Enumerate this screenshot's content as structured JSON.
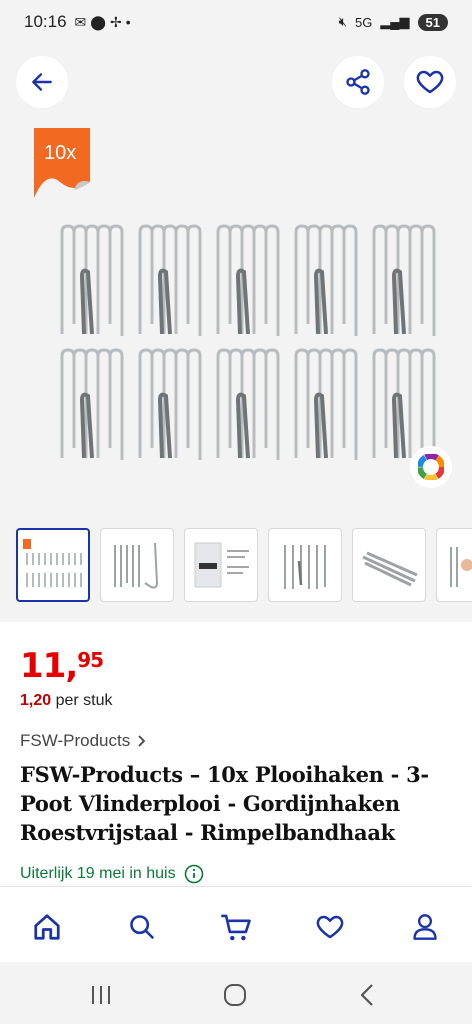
{
  "status_bar": {
    "time": "10:16",
    "battery": "51",
    "network": "5G"
  },
  "gallery": {
    "badge": "10x",
    "thumbnails_count": 6
  },
  "product": {
    "price_whole": "11,",
    "price_cents": "95",
    "unit_price_value": "1,20",
    "unit_price_label": "per stuk",
    "brand": "FSW-Products",
    "title": "FSW-Products – 10x Plooihaken - 3-Poot Vlinderplooi - Gordijnhaken Roestvrijstaal - Rimpelbandhaak",
    "delivery": "Uiterlijk 19 mei in huis"
  },
  "nav": {
    "items": [
      "home-icon",
      "search-icon",
      "cart-icon",
      "heart-icon",
      "user-icon"
    ]
  },
  "colors": {
    "accent": "#1a33a8",
    "price": "#e60000",
    "delivery": "#0a7a38",
    "badge": "#f26a21"
  }
}
